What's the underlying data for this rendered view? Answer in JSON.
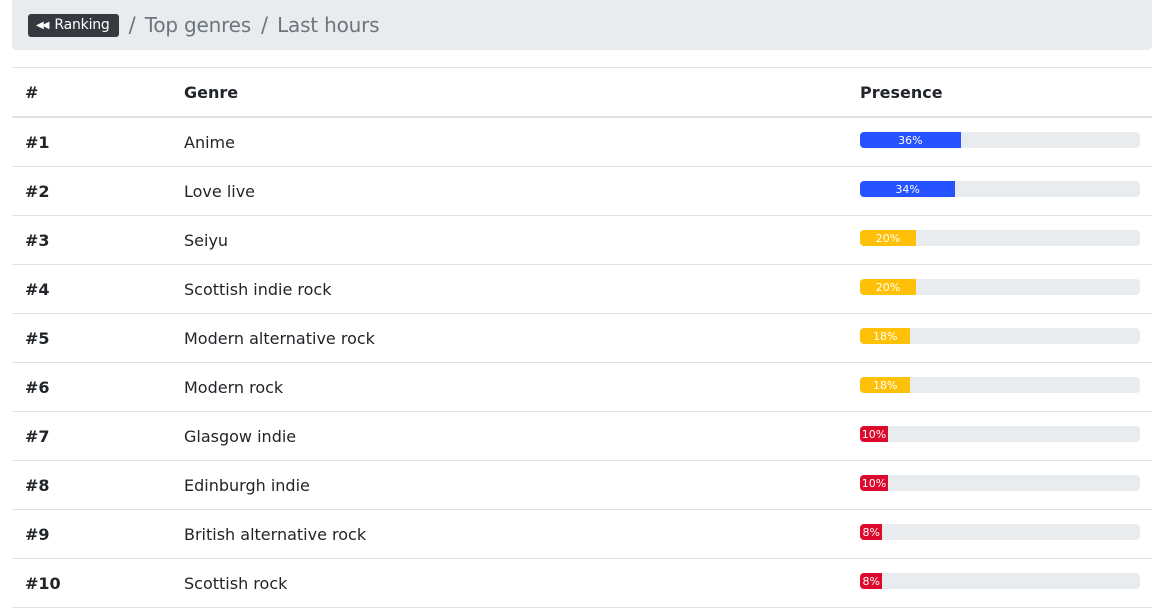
{
  "breadcrumb": {
    "back_label": "Ranking",
    "items": [
      "Top genres",
      "Last hours"
    ]
  },
  "table": {
    "headers": {
      "rank": "#",
      "genre": "Genre",
      "presence": "Presence"
    },
    "rows": [
      {
        "rank": "#1",
        "genre": "Anime",
        "presence": 36,
        "label": "36%",
        "color": "#2453ff"
      },
      {
        "rank": "#2",
        "genre": "Love live",
        "presence": 34,
        "label": "34%",
        "color": "#2453ff"
      },
      {
        "rank": "#3",
        "genre": "Seiyu",
        "presence": 20,
        "label": "20%",
        "color": "#ffc107"
      },
      {
        "rank": "#4",
        "genre": "Scottish indie rock",
        "presence": 20,
        "label": "20%",
        "color": "#ffc107"
      },
      {
        "rank": "#5",
        "genre": "Modern alternative rock",
        "presence": 18,
        "label": "18%",
        "color": "#ffc107"
      },
      {
        "rank": "#6",
        "genre": "Modern rock",
        "presence": 18,
        "label": "18%",
        "color": "#ffc107"
      },
      {
        "rank": "#7",
        "genre": "Glasgow indie",
        "presence": 10,
        "label": "10%",
        "color": "#dc0a2c"
      },
      {
        "rank": "#8",
        "genre": "Edinburgh indie",
        "presence": 10,
        "label": "10%",
        "color": "#dc0a2c"
      },
      {
        "rank": "#9",
        "genre": "British alternative rock",
        "presence": 8,
        "label": "8%",
        "color": "#dc0a2c"
      },
      {
        "rank": "#10",
        "genre": "Scottish rock",
        "presence": 8,
        "label": "8%",
        "color": "#dc0a2c"
      }
    ]
  }
}
